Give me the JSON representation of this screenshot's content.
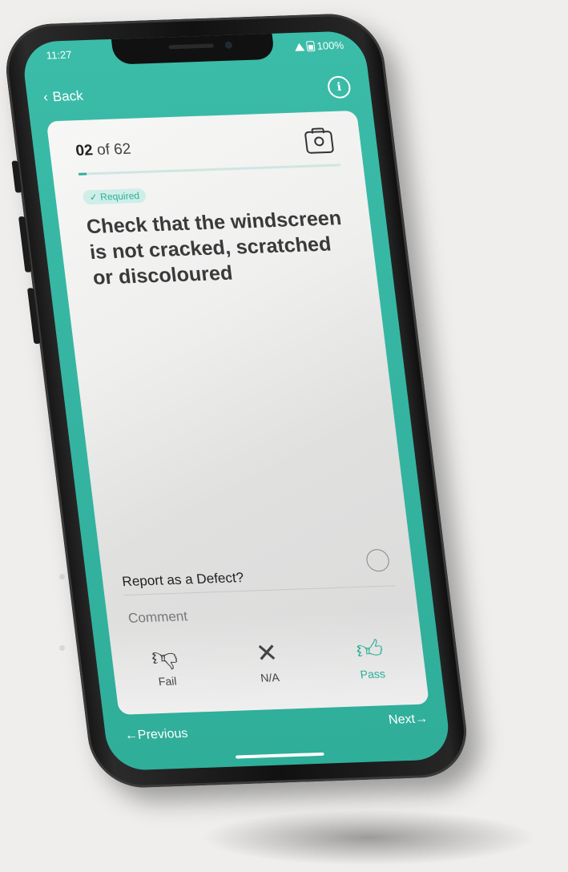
{
  "status_bar": {
    "time": "11:27",
    "battery": "100%"
  },
  "top_bar": {
    "back_label": "Back",
    "info_icon": "info-icon"
  },
  "card": {
    "progress_current": "02",
    "progress_separator": "of",
    "progress_total": "62",
    "progress_fraction": 0.032,
    "required_badge": "✓ Required",
    "question": "Check that the windscreen is not cracked, scratched or discoloured",
    "defect_label": "Report as a Defect?",
    "comment_placeholder": "Comment"
  },
  "actions": [
    {
      "label": "Fail",
      "icon": "thumbs-down-icon"
    },
    {
      "label": "N/A",
      "icon": "close-icon"
    },
    {
      "label": "Pass",
      "icon": "thumbs-up-icon"
    }
  ],
  "bottom_bar": {
    "previous_label": "←Previous",
    "next_label": "Next→"
  },
  "colors": {
    "accent": "#2fae9a",
    "card_bg": "#f3f3f2"
  }
}
